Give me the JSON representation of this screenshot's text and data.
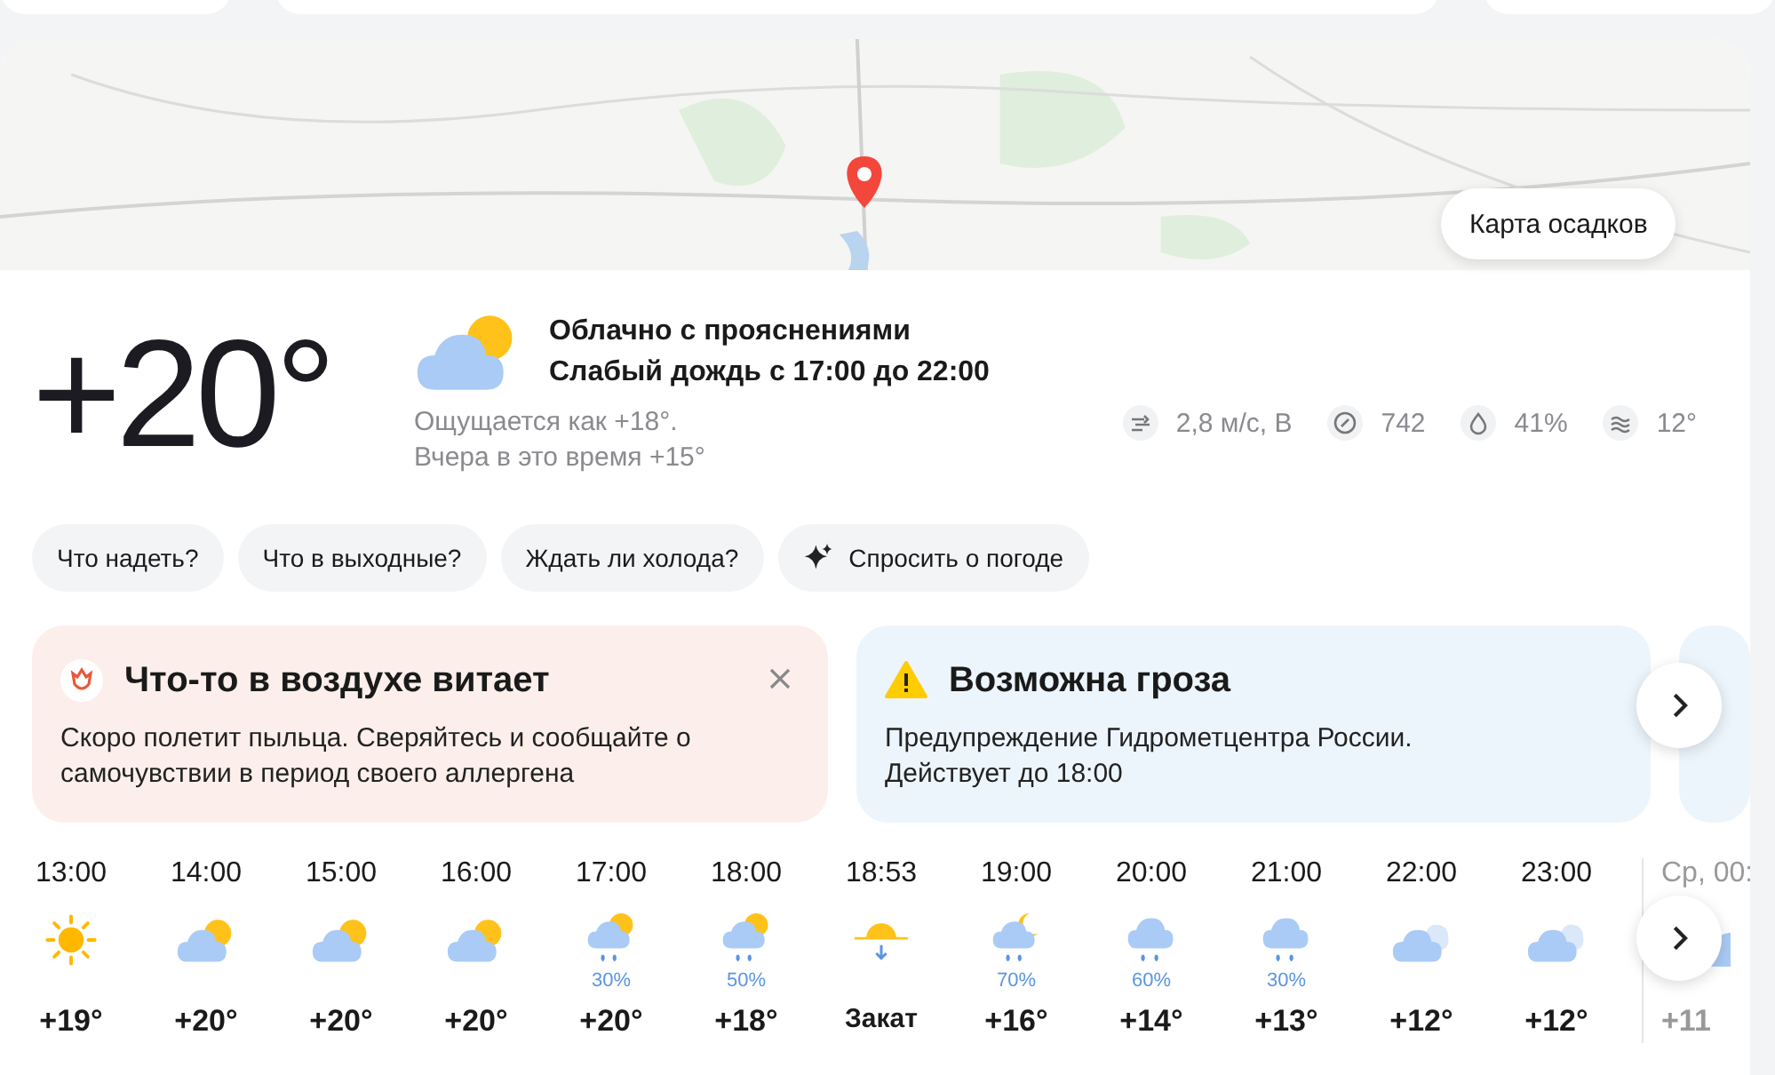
{
  "map": {
    "button": "Карта осадков"
  },
  "current": {
    "temperature": "+20°",
    "condition": "Облачно с прояснениями",
    "forecast": "Слабый дождь с 17:00 до 22:00",
    "feels_like": "Ощущается как +18°.",
    "yesterday": "Вчера в это время +15°",
    "details": [
      {
        "kind": "wind",
        "value": "2,8 м/с, В"
      },
      {
        "kind": "pressure",
        "value": "742"
      },
      {
        "kind": "humidity",
        "value": "41%"
      },
      {
        "kind": "water",
        "value": "12°"
      }
    ]
  },
  "chips": [
    {
      "label": "Что надеть?",
      "kind": "plain"
    },
    {
      "label": "Что в выходные?",
      "kind": "plain"
    },
    {
      "label": "Ждать ли холода?",
      "kind": "plain"
    },
    {
      "label": "Спросить о погоде",
      "kind": "sparkle"
    }
  ],
  "alerts": [
    {
      "kind": "pollen",
      "title": "Что-то в воздухе витает",
      "text": "Скоро полетит пыльца. Сверяйтесь и сообщайте о самочувствии в период своего аллергена",
      "closable": true
    },
    {
      "kind": "warning",
      "title": "Возможна гроза",
      "text": "Предупреждение Гидрометцентра России. Действует до 18:00",
      "closable": false
    }
  ],
  "hourly": [
    {
      "time": "13:00",
      "kind": "sun",
      "temp": "+19°",
      "next_day": false
    },
    {
      "time": "14:00",
      "kind": "partly",
      "temp": "+20°",
      "next_day": false
    },
    {
      "time": "15:00",
      "kind": "partly",
      "temp": "+20°",
      "next_day": false
    },
    {
      "time": "16:00",
      "kind": "partly",
      "temp": "+20°",
      "next_day": false
    },
    {
      "time": "17:00",
      "kind": "rainsun",
      "precip": "30%",
      "temp": "+20°",
      "next_day": false
    },
    {
      "time": "18:00",
      "kind": "rainsun",
      "precip": "50%",
      "temp": "+18°",
      "next_day": false
    },
    {
      "time": "18:53",
      "kind": "sunset",
      "temp": "Закат",
      "next_day": false
    },
    {
      "time": "19:00",
      "kind": "rainmoon",
      "precip": "70%",
      "temp": "+16°",
      "next_day": false
    },
    {
      "time": "20:00",
      "kind": "rain",
      "precip": "60%",
      "temp": "+14°",
      "next_day": false
    },
    {
      "time": "21:00",
      "kind": "rain",
      "precip": "30%",
      "temp": "+13°",
      "next_day": false
    },
    {
      "time": "22:00",
      "kind": "cloudy",
      "temp": "+12°",
      "next_day": false
    },
    {
      "time": "23:00",
      "kind": "cloudy",
      "temp": "+12°",
      "next_day": false
    },
    {
      "time": "Ср, 00:",
      "kind": "cloudy",
      "temp": "+11",
      "next_day": true
    }
  ]
}
